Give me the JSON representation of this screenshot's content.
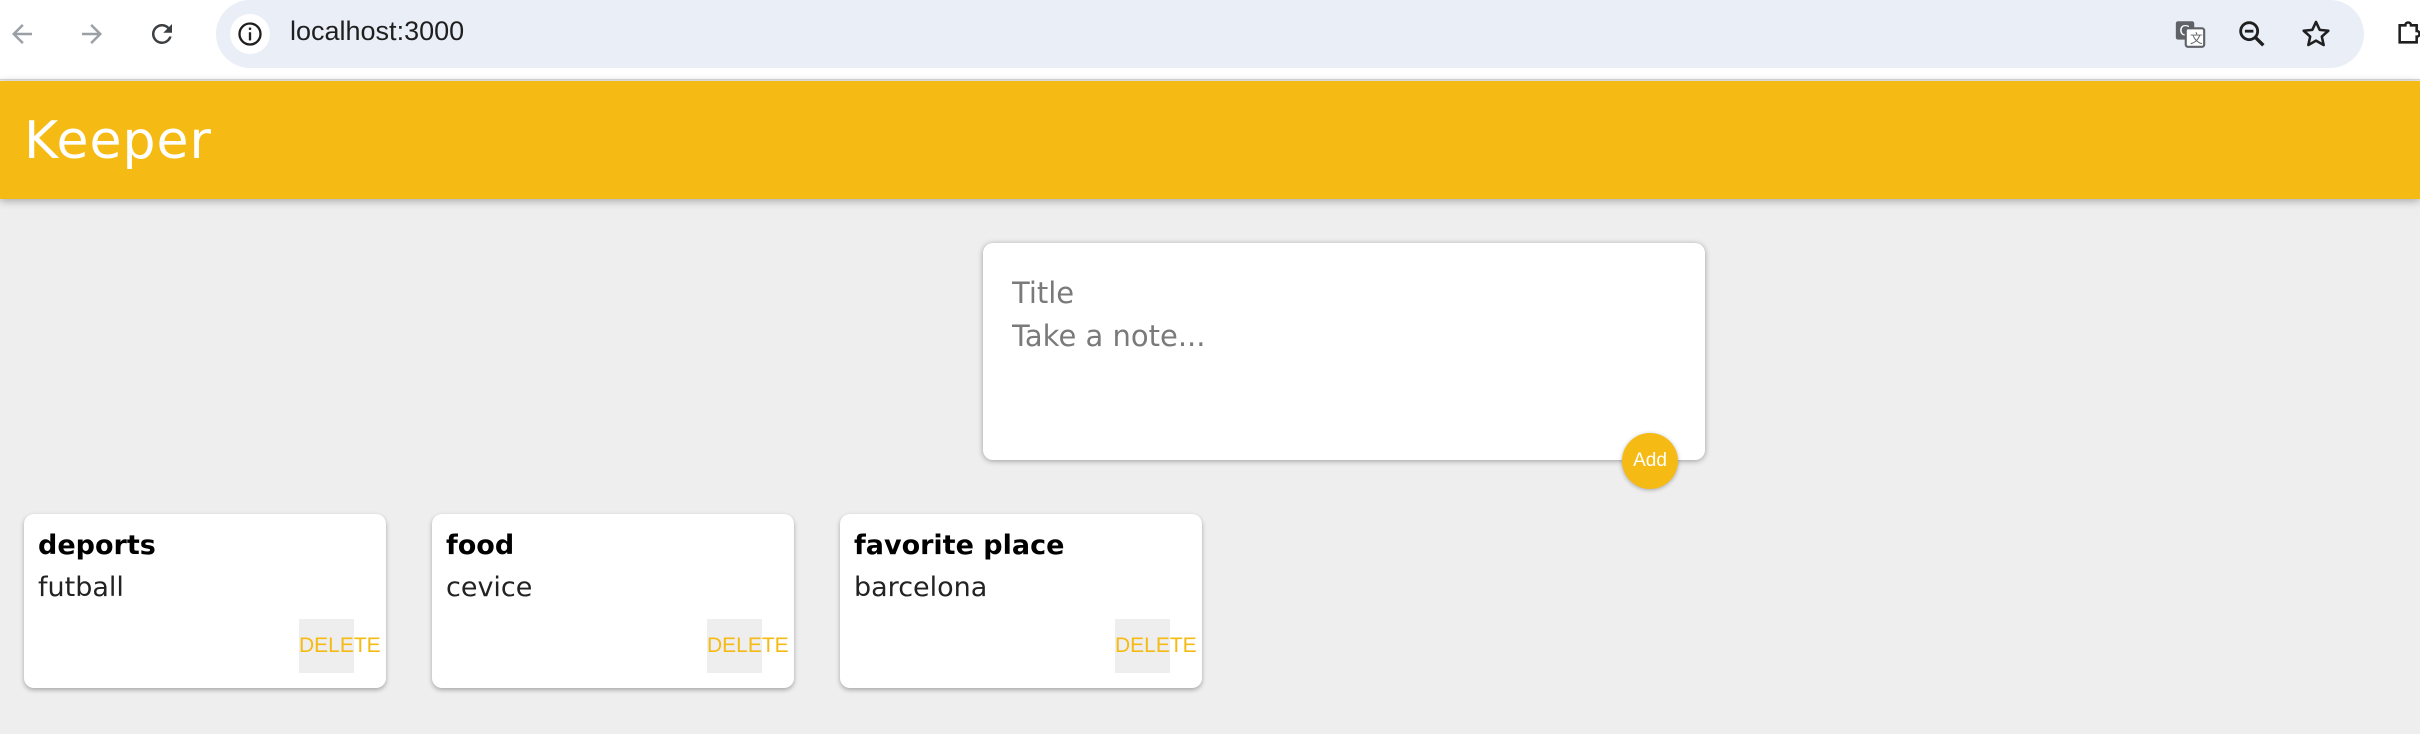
{
  "browser": {
    "url": "localhost:3000"
  },
  "header": {
    "title": "Keeper"
  },
  "create_area": {
    "title_placeholder": "Title",
    "content_placeholder": "Take a note...",
    "add_label": "Add"
  },
  "notes": [
    {
      "title": "deports",
      "content": "futball",
      "delete_label": "DELETE"
    },
    {
      "title": "food",
      "content": "cevice",
      "delete_label": "DELETE"
    },
    {
      "title": "favorite place",
      "content": "barcelona",
      "delete_label": "DELETE"
    }
  ],
  "colors": {
    "accent": "#f5ba13",
    "background": "#eeeeee",
    "card": "#ffffff"
  },
  "icons": {
    "back": "arrow-left-icon",
    "forward": "arrow-right-icon",
    "reload": "reload-icon",
    "site_info": "info-icon",
    "translate": "translate-icon",
    "zoom": "zoom-out-icon",
    "bookmark": "star-icon",
    "extensions": "puzzle-icon"
  }
}
